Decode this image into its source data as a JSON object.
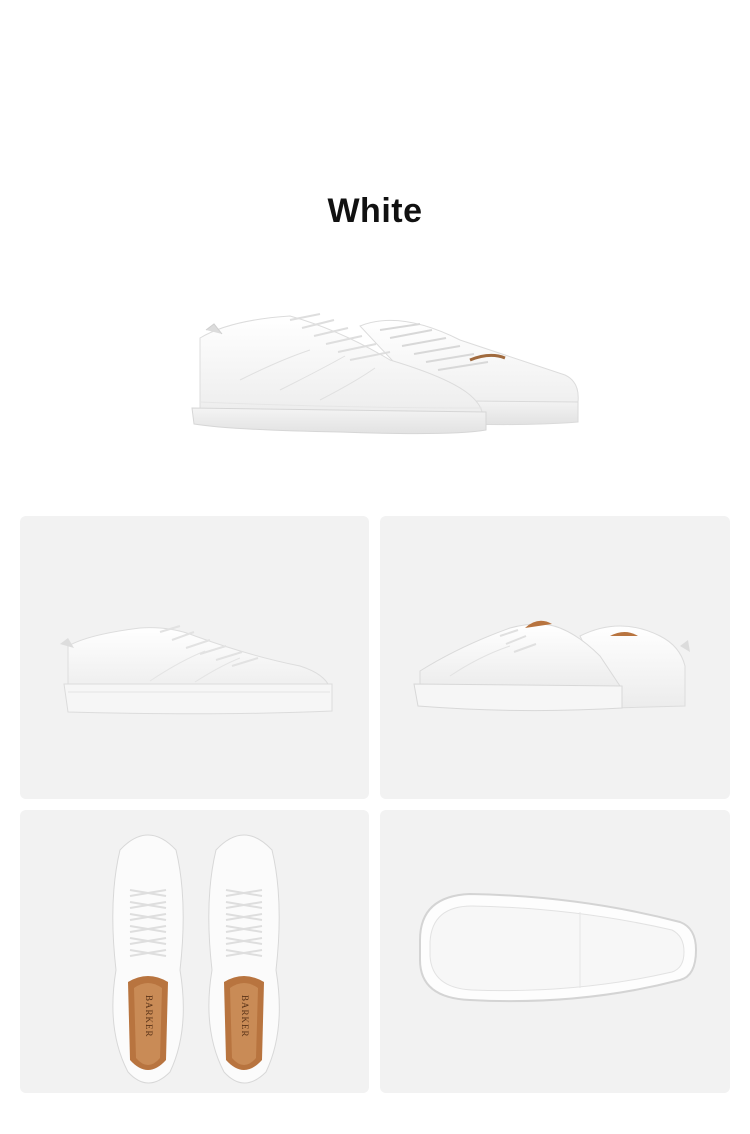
{
  "color_heading": {
    "title": "White"
  },
  "insole_brand_text": "BARKER",
  "colors": {
    "page_background": "#ffffff",
    "tile_background": "#f2f2f2",
    "leather": "#fafafa",
    "lining": "#b8743f"
  },
  "gallery": {
    "images": [
      {
        "view": "side-profile"
      },
      {
        "view": "rear-three-quarter"
      },
      {
        "view": "top-down-pair"
      },
      {
        "view": "sole-bottom"
      }
    ]
  }
}
